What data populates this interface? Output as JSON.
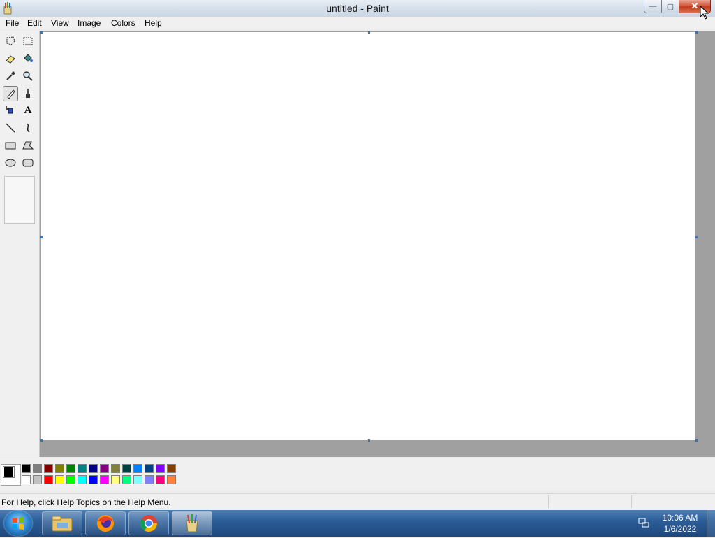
{
  "window": {
    "title": "untitled - Paint",
    "minimize_symbol": "—",
    "maximize_symbol": "▢",
    "close_symbol": "✕"
  },
  "menubar": {
    "items": [
      {
        "label": "File"
      },
      {
        "label": "Edit"
      },
      {
        "label": "View"
      },
      {
        "label": "Image"
      },
      {
        "label": "Colors"
      },
      {
        "label": "Help"
      }
    ]
  },
  "toolbox": {
    "tools": [
      {
        "name": "free-form-select-icon"
      },
      {
        "name": "rectangle-select-icon"
      },
      {
        "name": "eraser-icon"
      },
      {
        "name": "fill-bucket-icon"
      },
      {
        "name": "color-picker-icon"
      },
      {
        "name": "magnifier-icon"
      },
      {
        "name": "pencil-icon",
        "selected": true
      },
      {
        "name": "brush-icon"
      },
      {
        "name": "airbrush-icon"
      },
      {
        "name": "text-icon",
        "glyph": "A"
      },
      {
        "name": "line-icon"
      },
      {
        "name": "curve-icon"
      },
      {
        "name": "rectangle-icon"
      },
      {
        "name": "polygon-icon"
      },
      {
        "name": "ellipse-icon"
      },
      {
        "name": "rounded-rectangle-icon"
      }
    ]
  },
  "palette": {
    "foreground": "#000000",
    "background": "#ffffff",
    "row1": [
      "#000000",
      "#808080",
      "#800000",
      "#808000",
      "#008000",
      "#008080",
      "#000080",
      "#800080",
      "#808040",
      "#004040",
      "#0080ff",
      "#004080",
      "#8000ff",
      "#804000"
    ],
    "row2": [
      "#ffffff",
      "#c0c0c0",
      "#ff0000",
      "#ffff00",
      "#00ff00",
      "#00ffff",
      "#0000ff",
      "#ff00ff",
      "#ffff80",
      "#00ff80",
      "#80ffff",
      "#8080ff",
      "#ff0080",
      "#ff8040"
    ]
  },
  "status": {
    "help_text": "For Help, click Help Topics on the Help Menu."
  },
  "taskbar": {
    "apps": [
      {
        "name": "file-explorer-icon"
      },
      {
        "name": "firefox-icon"
      },
      {
        "name": "chrome-icon"
      },
      {
        "name": "paint-icon",
        "active": true
      }
    ],
    "clock_time": "10:06 AM",
    "clock_date": "1/6/2022"
  }
}
